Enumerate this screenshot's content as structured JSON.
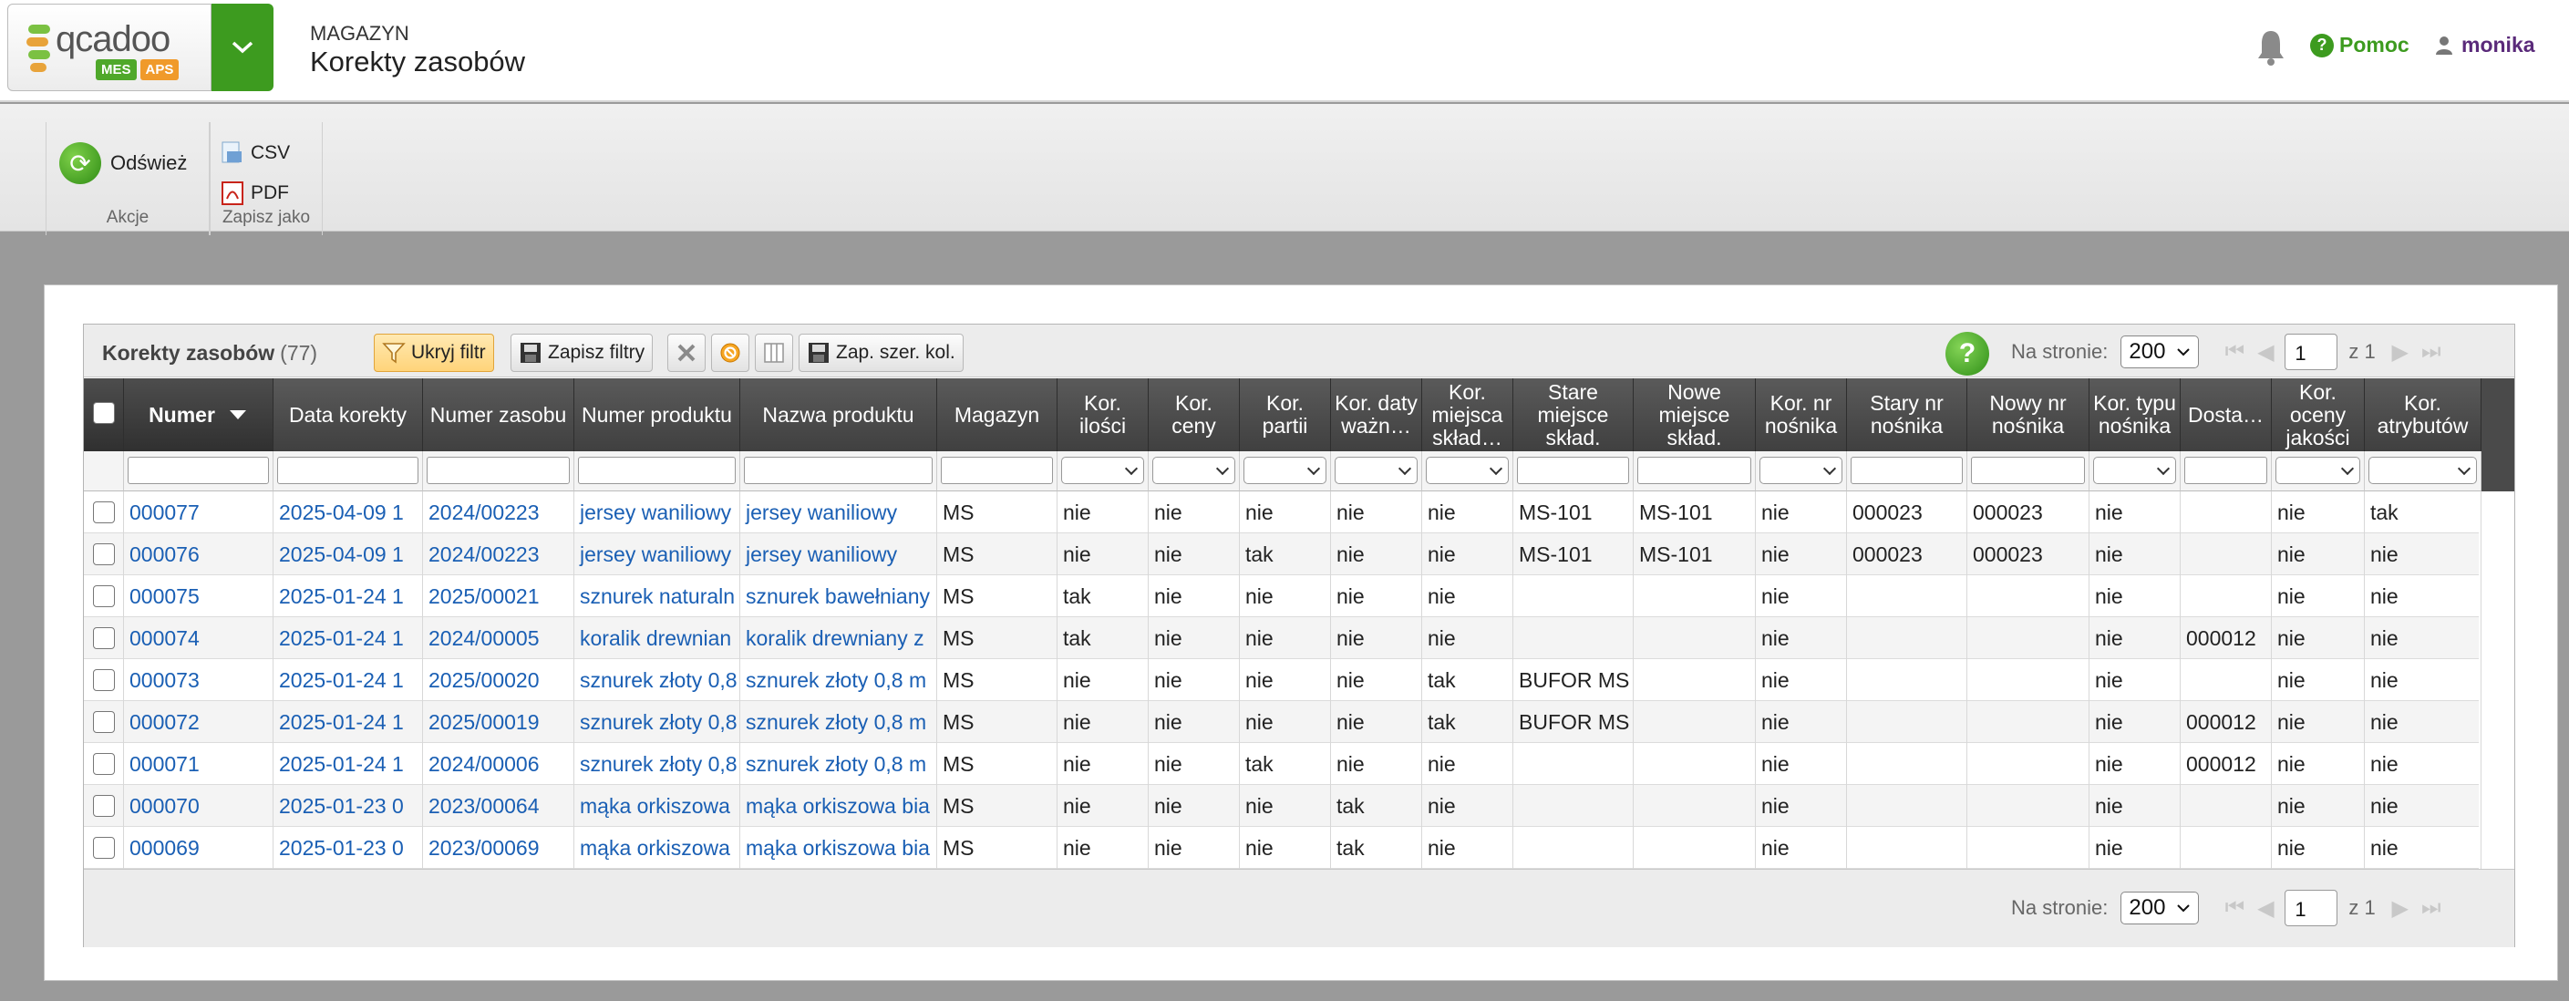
{
  "header": {
    "logo_text": "qcadoo",
    "logo_badges": [
      "MES",
      "APS"
    ],
    "section": "MAGAZYN",
    "title": "Korekty zasobów",
    "help_label": "Pomoc",
    "user_label": "monika"
  },
  "ribbon": {
    "refresh_label": "Odśwież",
    "actions_group": "Akcje",
    "csv_label": "CSV",
    "pdf_label": "PDF",
    "save_as_group": "Zapisz jako"
  },
  "grid": {
    "title": "Korekty zasobów",
    "count": "(77)",
    "hide_filter_label": "Ukryj filtr",
    "save_filters_label": "Zapisz filtry",
    "save_col_width_label": "Zap. szer. kol.",
    "per_page_label": "Na stronie:",
    "per_page_value": "200",
    "page_value": "1",
    "page_total": "z 1",
    "columns": [
      "Numer",
      "Data korekty",
      "Numer zasobu",
      "Numer produktu",
      "Nazwa produktu",
      "Magazyn",
      "Kor. ilości",
      "Kor. ceny",
      "Kor. partii",
      "Kor. daty ważn…",
      "Kor. miejsca skład…",
      "Stare miejsce skład.",
      "Nowe miejsce skład.",
      "Kor. nr nośnika",
      "Stary nr nośnika",
      "Nowy nr nośnika",
      "Kor. typu nośnika",
      "Dosta…",
      "Kor. oceny jakości",
      "Kor. atrybutów"
    ],
    "rows": [
      [
        "000077",
        "2025-04-09 1",
        "2024/00223",
        "jersey waniliowy",
        "jersey waniliowy",
        "MS",
        "nie",
        "nie",
        "nie",
        "nie",
        "nie",
        "MS-101",
        "MS-101",
        "nie",
        "000023",
        "000023",
        "nie",
        "",
        "nie",
        "tak"
      ],
      [
        "000076",
        "2025-04-09 1",
        "2024/00223",
        "jersey waniliowy",
        "jersey waniliowy",
        "MS",
        "nie",
        "nie",
        "tak",
        "nie",
        "nie",
        "MS-101",
        "MS-101",
        "nie",
        "000023",
        "000023",
        "nie",
        "",
        "nie",
        "nie"
      ],
      [
        "000075",
        "2025-01-24 1",
        "2025/00021",
        "sznurek naturaln",
        "sznurek bawełniany",
        "MS",
        "tak",
        "nie",
        "nie",
        "nie",
        "nie",
        "",
        "",
        "nie",
        "",
        "",
        "nie",
        "",
        "nie",
        "nie"
      ],
      [
        "000074",
        "2025-01-24 1",
        "2024/00005",
        "koralik drewnian",
        "koralik drewniany z",
        "MS",
        "tak",
        "nie",
        "nie",
        "nie",
        "nie",
        "",
        "",
        "nie",
        "",
        "",
        "nie",
        "000012",
        "nie",
        "nie"
      ],
      [
        "000073",
        "2025-01-24 1",
        "2025/00020",
        "sznurek złoty 0,8",
        "sznurek złoty 0,8 m",
        "MS",
        "nie",
        "nie",
        "nie",
        "nie",
        "tak",
        "BUFOR MS",
        "",
        "nie",
        "",
        "",
        "nie",
        "",
        "nie",
        "nie"
      ],
      [
        "000072",
        "2025-01-24 1",
        "2025/00019",
        "sznurek złoty 0,8",
        "sznurek złoty 0,8 m",
        "MS",
        "nie",
        "nie",
        "nie",
        "nie",
        "tak",
        "BUFOR MS",
        "",
        "nie",
        "",
        "",
        "nie",
        "000012",
        "nie",
        "nie"
      ],
      [
        "000071",
        "2025-01-24 1",
        "2024/00006",
        "sznurek złoty 0,8",
        "sznurek złoty 0,8 m",
        "MS",
        "nie",
        "nie",
        "tak",
        "nie",
        "nie",
        "",
        "",
        "nie",
        "",
        "",
        "nie",
        "000012",
        "nie",
        "nie"
      ],
      [
        "000070",
        "2025-01-23 0",
        "2023/00064",
        "mąka orkiszowa",
        "mąka orkiszowa bia",
        "MS",
        "nie",
        "nie",
        "nie",
        "tak",
        "nie",
        "",
        "",
        "nie",
        "",
        "",
        "nie",
        "",
        "nie",
        "nie"
      ],
      [
        "000069",
        "2025-01-23 0",
        "2023/00069",
        "mąka orkiszowa",
        "mąka orkiszowa bia",
        "MS",
        "nie",
        "nie",
        "nie",
        "tak",
        "nie",
        "",
        "",
        "nie",
        "",
        "",
        "nie",
        "",
        "nie",
        "nie"
      ]
    ]
  },
  "colors": {
    "brand_green": "#3d9b1f",
    "link_blue": "#1a5fb4",
    "header_dark": "#4a4a4a"
  }
}
